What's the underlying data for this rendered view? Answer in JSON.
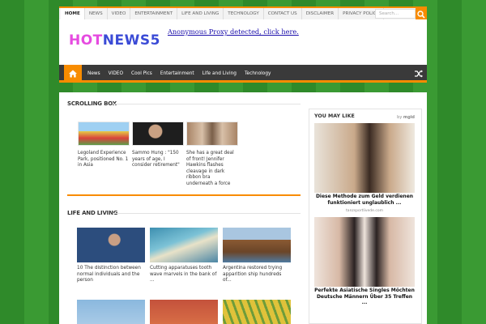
{
  "topnav": {
    "items": [
      "HOME",
      "NEWS",
      "VIDEO",
      "ENTERTAINMENT",
      "LIFE AND LIVING",
      "TECHNOLOGY",
      "CONTACT US",
      "DISCLAIMER",
      "PRIVACY POLICY"
    ],
    "search_placeholder": "Search...",
    "search_icon": "search-icon"
  },
  "header": {
    "logo_part1": "HOT",
    "logo_part2": "NEWS5",
    "proxy_text": "Anonymous Proxy detected, click here."
  },
  "mainnav": {
    "home_icon": "home-icon",
    "links": [
      "News",
      "VIDEO",
      "Cool Pics",
      "Entertainment",
      "Life and Living",
      "Technology"
    ],
    "shuffle_icon": "shuffle-icon"
  },
  "scrolling_box": {
    "title": "SCROLLING BOX",
    "items": [
      {
        "text": "Legoland Experience Park, positioned No. 1 in Asia",
        "thumb": "#7fb3de"
      },
      {
        "text": "Sammo Hung : \"150 years of age, I consider retirement\"",
        "thumb": "#2b2b2b"
      },
      {
        "text": "She has a great deal of front! Jennifer Hawkins flashes cleavage in dark ribbon bra underneath a force",
        "thumb": "#b8977a"
      }
    ]
  },
  "life_and_living": {
    "title": "LIFE AND LIVING",
    "items": [
      {
        "text": "10 The distinction between normal individuals and the person",
        "thumb": "#5a7fb0"
      },
      {
        "text": "Cutting apparatuses tooth wave marvels in the bank of ...",
        "thumb": "#4f9bb4"
      },
      {
        "text": "Argentina restored trying apparition ship hundreds of...",
        "thumb": "#9f7b52"
      }
    ],
    "row2_thumbs": [
      "#85b4d9",
      "#c44e38",
      "#d6b532"
    ]
  },
  "sidebar": {
    "title": "YOU MAY LIKE",
    "by_label": "by",
    "brand": "mgid",
    "ads": [
      {
        "caption": "Diese Methode zum Geld verdienen funktioniert unglaublich ...",
        "source": "tanzsportlivede.com",
        "bg": "#c9a98a"
      },
      {
        "caption": "Perfekte Asiatische Singles Möchten Deutsche Männern Über 35 Treffen ...",
        "source": "",
        "bg": "#d7b8a5"
      }
    ]
  },
  "colors": {
    "accent": "#f88c00",
    "nav_dark": "#3a3a3a",
    "link": "#1a0dab"
  }
}
